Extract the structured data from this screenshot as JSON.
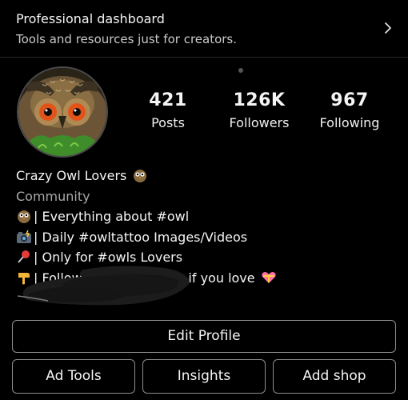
{
  "dashboard": {
    "title": "Professional dashboard",
    "subtitle": "Tools and resources just for creators."
  },
  "profile": {
    "avatar": "owl-avatar",
    "stats": [
      {
        "value": "421",
        "label": "Posts"
      },
      {
        "value": "126K",
        "label": "Followers"
      },
      {
        "value": "967",
        "label": "Following"
      }
    ]
  },
  "bio": {
    "name": "Crazy Owl Lovers",
    "category": "Community",
    "lines": [
      "| Everything about #owl",
      "| Daily #owltattoo Images/Videos",
      "| Only for #owls Lovers",
      "| Follow (",
      "s if you love"
    ]
  },
  "buttons": {
    "edit_profile": "Edit Profile",
    "ad_tools": "Ad Tools",
    "insights": "Insights",
    "add_shop": "Add shop"
  }
}
